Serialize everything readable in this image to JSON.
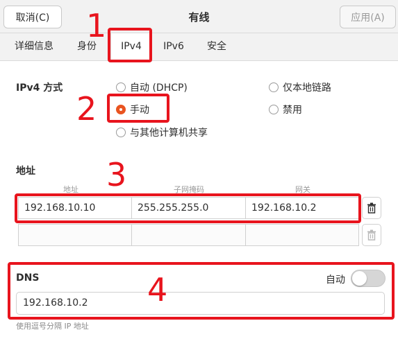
{
  "header": {
    "cancel_label": "取消(C)",
    "title": "有线",
    "apply_label": "应用(A)"
  },
  "tabs": [
    {
      "label": "详细信息"
    },
    {
      "label": "身份"
    },
    {
      "label": "IPv4"
    },
    {
      "label": "IPv6"
    },
    {
      "label": "安全"
    }
  ],
  "active_tab": "IPv4",
  "ipv4": {
    "method_label": "IPv4 方式",
    "options": [
      {
        "label": "自动 (DHCP)",
        "selected": false
      },
      {
        "label": "仅本地链路",
        "selected": false
      },
      {
        "label": "手动",
        "selected": true
      },
      {
        "label": "禁用",
        "selected": false
      },
      {
        "label": "与其他计算机共享",
        "selected": false
      }
    ]
  },
  "addresses": {
    "section_label": "地址",
    "headers": [
      "地址",
      "子网掩码",
      "网关"
    ],
    "rows": [
      [
        "192.168.10.10",
        "255.255.255.0",
        "192.168.10.2"
      ],
      [
        "",
        "",
        ""
      ]
    ]
  },
  "dns": {
    "label": "DNS",
    "auto_label": "自动",
    "auto_enabled": false,
    "value": "192.168.10.2",
    "hint": "使用逗号分隔 IP 地址"
  },
  "annotations": [
    "1",
    "2",
    "3",
    "4"
  ],
  "colors": {
    "accent": "#e95420",
    "annotation_red": "#e8141d"
  }
}
